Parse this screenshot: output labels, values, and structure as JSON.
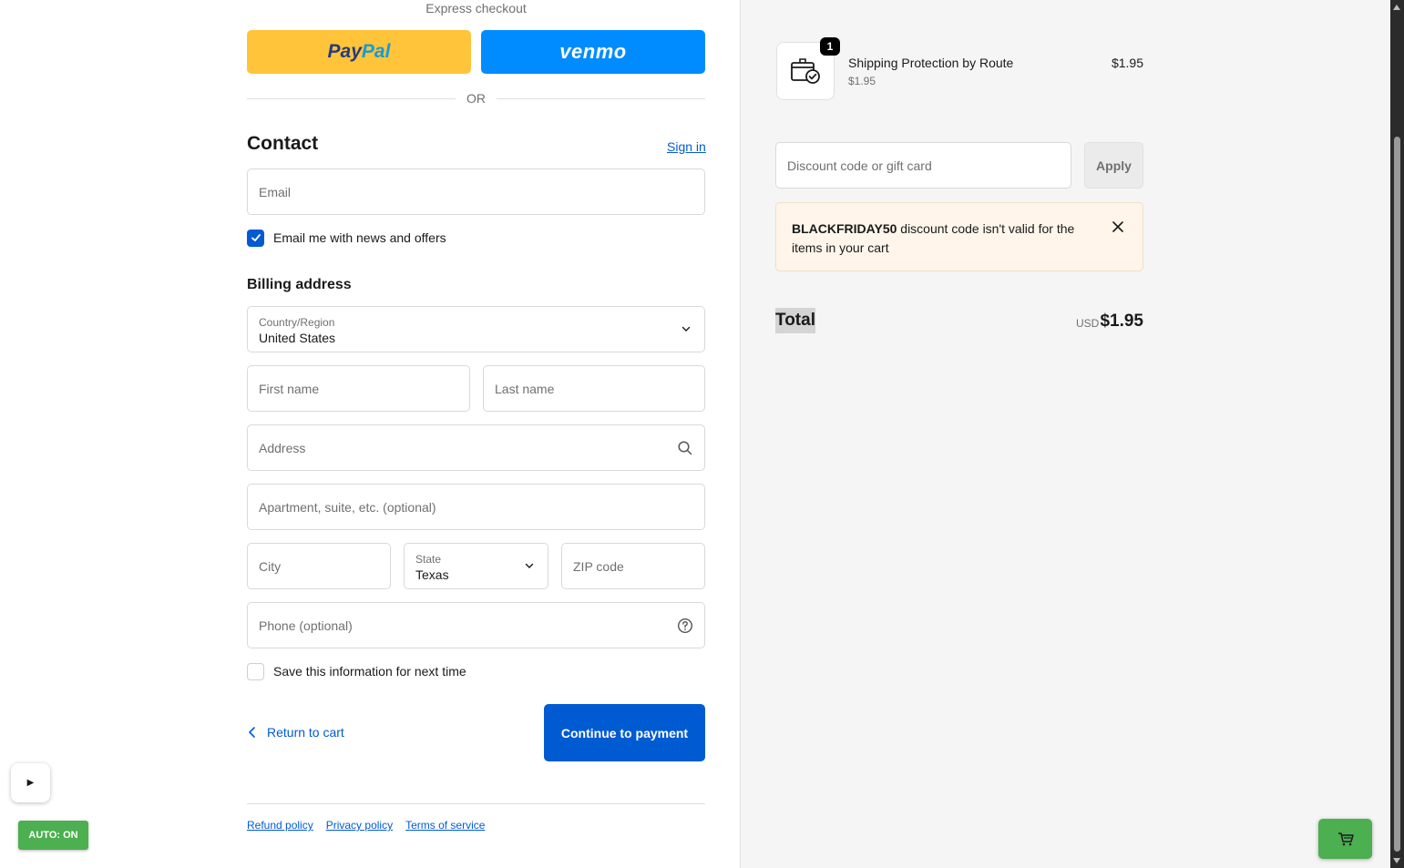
{
  "express": {
    "label": "Express checkout",
    "paypal_part1": "Pay",
    "paypal_part2": "Pal",
    "venmo_label": "venmo",
    "or_label": "OR"
  },
  "contact": {
    "heading": "Contact",
    "sign_in": "Sign in",
    "email_placeholder": "Email",
    "news_label": "Email me with news and offers",
    "news_checked": true
  },
  "billing": {
    "heading": "Billing address",
    "country_label": "Country/Region",
    "country_value": "United States",
    "first_name_placeholder": "First name",
    "last_name_placeholder": "Last name",
    "address_placeholder": "Address",
    "apartment_placeholder": "Apartment, suite, etc. (optional)",
    "city_placeholder": "City",
    "state_label": "State",
    "state_value": "Texas",
    "zip_placeholder": "ZIP code",
    "phone_placeholder": "Phone (optional)",
    "save_label": "Save this information for next time",
    "save_checked": false
  },
  "actions": {
    "return_label": "Return to cart",
    "continue_label": "Continue to payment"
  },
  "footer": {
    "links": [
      "Refund policy",
      "Privacy policy",
      "Terms of service"
    ]
  },
  "overlay": {
    "play_symbol": "▶",
    "auto_label": "AUTO: ON"
  },
  "summary": {
    "item": {
      "quantity": "1",
      "name": "Shipping Protection by Route",
      "sub_price": "$1.95",
      "price": "$1.95"
    },
    "discount_placeholder": "Discount code or gift card",
    "apply_label": "Apply",
    "alert_code": "BLACKFRIDAY50",
    "alert_text": " discount code isn't valid for the items in your cart",
    "total_label": "Total",
    "currency": "USD",
    "total_value": "$1.95"
  },
  "colors": {
    "primary": "#005bd3",
    "paypal": "#ffc439",
    "venmo": "#008cff",
    "alert_bg": "#fff5ea",
    "auto_badge": "#4caf50"
  }
}
